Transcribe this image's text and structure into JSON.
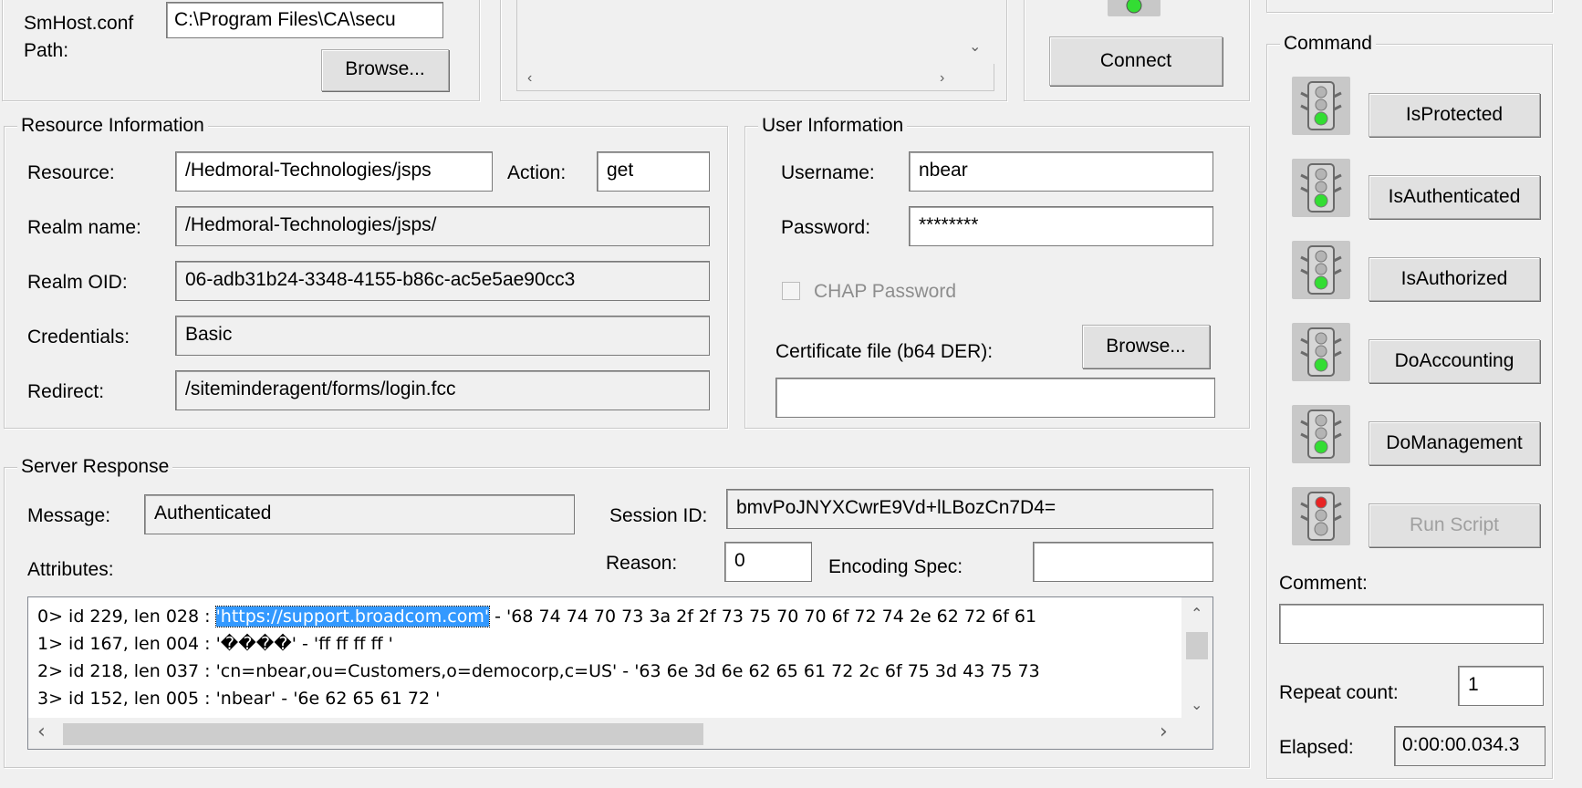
{
  "config": {
    "smhost_label": "SmHost.conf",
    "path_label": "Path:",
    "smhost_path": "C:\\Program Files\\CA\\secu",
    "browse_label": "Browse..."
  },
  "connect": {
    "connect_label": "Connect"
  },
  "resource": {
    "title": "Resource Information",
    "resource_label": "Resource:",
    "resource_value": "/Hedmoral-Technologies/jsps",
    "action_label": "Action:",
    "action_value": "get",
    "realm_name_label": "Realm name:",
    "realm_name_value": "/Hedmoral-Technologies/jsps/",
    "realm_oid_label": "Realm OID:",
    "realm_oid_value": "06-adb31b24-3348-4155-b86c-ac5e5ae90cc3",
    "credentials_label": "Credentials:",
    "credentials_value": "Basic",
    "redirect_label": "Redirect:",
    "redirect_value": "/siteminderagent/forms/login.fcc"
  },
  "user": {
    "title": "User Information",
    "username_label": "Username:",
    "username_value": "nbear",
    "password_label": "Password:",
    "password_value": "********",
    "chap_label": "CHAP Password",
    "cert_label": "Certificate file (b64 DER):",
    "browse_label": "Browse...",
    "cert_value": ""
  },
  "response": {
    "title": "Server Response",
    "message_label": "Message:",
    "message_value": "Authenticated",
    "session_label": "Session ID:",
    "session_value": "bmvPoJNYXCwrE9Vd+lLBozCn7D4=",
    "attributes_label": "Attributes:",
    "reason_label": "Reason:",
    "reason_value": "0",
    "encoding_label": "Encoding Spec:",
    "encoding_value": "",
    "attr0_prefix": "0> id 229, len 028 : ",
    "attr0_selected": "'https://support.broadcom.com'",
    "attr0_suffix": " - '68 74 74 70 73 3a 2f 2f 73 75 70 70 6f 72 74 2e 62 72 6f 61",
    "attr1": "1> id 167, len 004 : '\u0000\u0000\u0000\u0000' - 'ff ff ff ff '",
    "attr1_display": "1> id 167, len 004 : '����' - 'ff ff ff ff '",
    "attr2": "2> id 218, len 037 : 'cn=nbear,ou=Customers,o=democorp,c=US' - '63 6e 3d 6e 62 65 61 72 2c 6f 75 3d 43 75 73",
    "attr3": "3> id 152, len 005 : 'nbear' - '6e 62 65 61 72 '"
  },
  "command": {
    "title": "Command",
    "buttons": [
      "IsProtected",
      "IsAuthenticated",
      "IsAuthorized",
      "DoAccounting",
      "DoManagement",
      "Run Script"
    ],
    "lights": [
      "green",
      "green",
      "green",
      "green",
      "green",
      "red"
    ],
    "comment_label": "Comment:",
    "comment_value": "",
    "repeat_label": "Repeat count:",
    "repeat_value": "1",
    "elapsed_label": "Elapsed:",
    "elapsed_value": "0:00:00.034.3"
  },
  "colors": {
    "green": "#33dd33",
    "red": "#e82424",
    "gray": "#b4b4b4"
  }
}
